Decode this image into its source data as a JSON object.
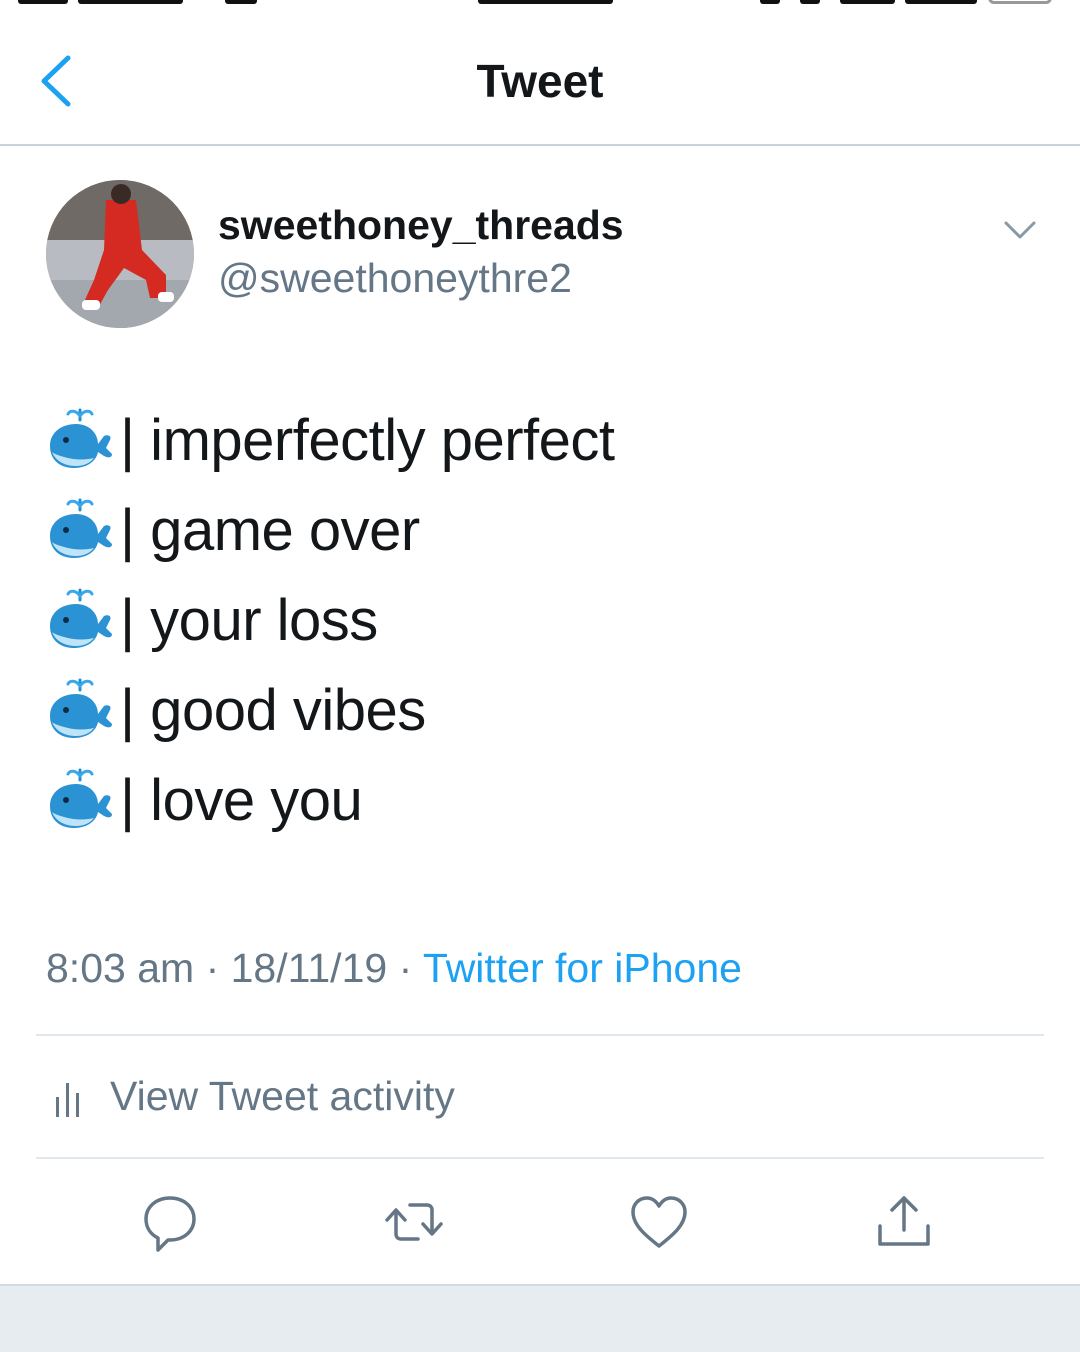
{
  "header": {
    "title": "Tweet",
    "back_icon": "chevron-left-icon"
  },
  "tweet": {
    "author": {
      "display_name": "sweethoney_threads",
      "handle": "@sweethoneythre2"
    },
    "lines": [
      {
        "emoji": "spouting-whale",
        "text": "| imperfectly perfect"
      },
      {
        "emoji": "spouting-whale",
        "text": "| game over"
      },
      {
        "emoji": "spouting-whale",
        "text": "| your loss"
      },
      {
        "emoji": "spouting-whale",
        "text": "| good vibes"
      },
      {
        "emoji": "spouting-whale",
        "text": "| love you"
      }
    ],
    "time": "8:03 am",
    "separator": "·",
    "date": "18/11/19",
    "source": "Twitter for iPhone"
  },
  "activity": {
    "label": "View Tweet activity",
    "icon": "bar-chart-icon"
  },
  "actions": [
    "reply-icon",
    "retweet-icon",
    "like-icon",
    "share-icon"
  ],
  "colors": {
    "accent": "#1da1f2",
    "secondary_text": "#657786",
    "primary_text": "#14171a",
    "divider": "#e1e8ed"
  }
}
